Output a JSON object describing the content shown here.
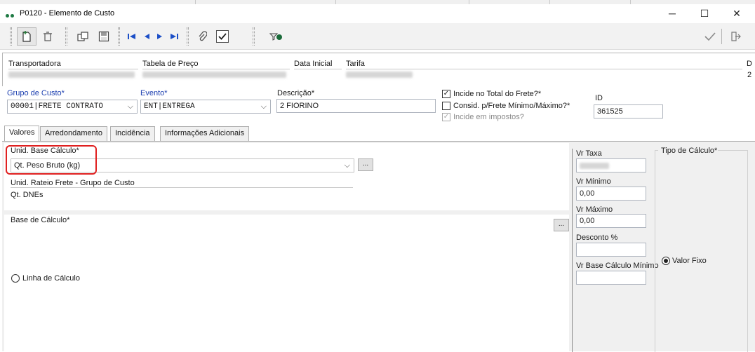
{
  "window": {
    "title": "P0120 - Elemento de Custo",
    "minimize": "─",
    "maximize": "☐",
    "close": "✕"
  },
  "toolbar": {
    "icons": [
      "new-record-icon",
      "delete-icon",
      "copy-icon",
      "save-icon",
      "first-record-icon",
      "previous-record-icon",
      "next-record-icon",
      "last-record-icon",
      "attach-icon",
      "confirm-checkbox-icon",
      "search-filter-icon",
      "ok-icon",
      "exit-icon"
    ]
  },
  "header": {
    "transportadora_label": "Transportadora",
    "tabela_label": "Tabela de Preço",
    "data_inicial_label": "Data Inicial",
    "tarifa_label": "Tarifa",
    "extra_label": "D",
    "extra_value": "2"
  },
  "fields": {
    "grupo_label": "Grupo de Custo*",
    "grupo_value": "00001|FRETE CONTRATO",
    "evento_label": "Evento*",
    "evento_value": "ENT|ENTREGA",
    "descricao_label": "Descrição*",
    "descricao_value": "2 FIORINO",
    "incide_total_label": "Incide no Total do Frete?*",
    "consid_label": "Consid. p/Frete Mínimo/Máximo?*",
    "incide_impostos_label": "Incide em impostos?",
    "id_label": "ID",
    "id_value": "361525"
  },
  "tabs": [
    "Valores",
    "Arredondamento",
    "Incidência",
    "Informações Adicionais"
  ],
  "valores": {
    "unid_base_label": "Unid. Base Cálculo*",
    "unid_base_value": "Qt. Peso Bruto (kg)",
    "unid_rateio_label": "Unid. Rateio Frete - Grupo de Custo",
    "unid_rateio_value": "Qt. DNEs",
    "base_calculo_label": "Base de Cálculo*",
    "linha_calculo_label": "Linha de Cálculo",
    "browse_label": "...",
    "vr_taxa_label": "Vr Taxa",
    "vr_minimo_label": "Vr Mínimo",
    "vr_minimo_value": "0,00",
    "vr_maximo_label": "Vr Máximo",
    "vr_maximo_value": "0,00",
    "desconto_label": "Desconto %",
    "desconto_value": "",
    "vr_base_minimo_label": "Vr Base Cálculo Mínimo",
    "vr_base_minimo_value": "",
    "tipo_calculo_label": "Tipo de Cálculo*",
    "valor_fixo_label": "Valor Fixo"
  },
  "colors": {
    "accent_red": "#e02020",
    "label_blue": "#1c3fb0",
    "brand_green": "#1e7a43"
  }
}
